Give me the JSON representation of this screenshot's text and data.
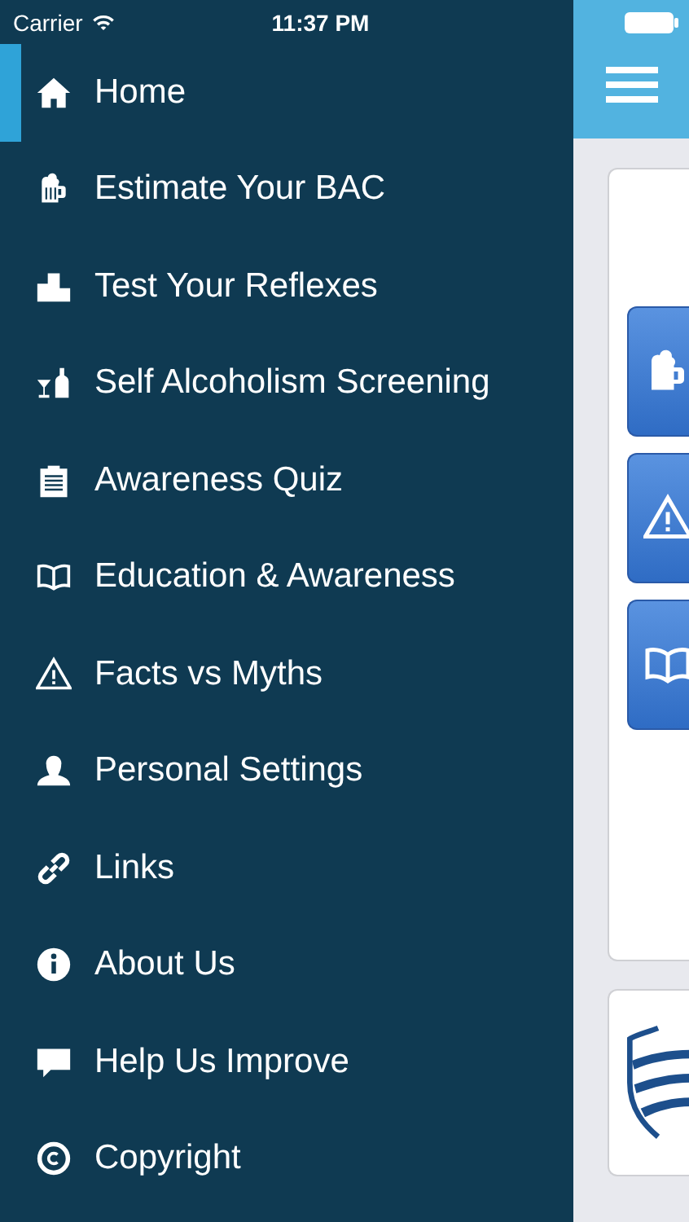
{
  "status_bar": {
    "carrier": "Carrier",
    "time": "11:37 PM"
  },
  "menu": [
    {
      "label": "Home",
      "selected": true
    },
    {
      "label": "Estimate Your BAC",
      "selected": false
    },
    {
      "label": "Test Your Reflexes",
      "selected": false
    },
    {
      "label": "Self Alcoholism Screening",
      "selected": false
    },
    {
      "label": "Awareness Quiz",
      "selected": false
    },
    {
      "label": "Education & Awareness",
      "selected": false
    },
    {
      "label": "Facts vs Myths",
      "selected": false
    },
    {
      "label": "Personal Settings",
      "selected": false
    },
    {
      "label": "Links",
      "selected": false
    },
    {
      "label": "About Us",
      "selected": false
    },
    {
      "label": "Help Us Improve",
      "selected": false
    },
    {
      "label": "Copyright",
      "selected": false
    }
  ]
}
